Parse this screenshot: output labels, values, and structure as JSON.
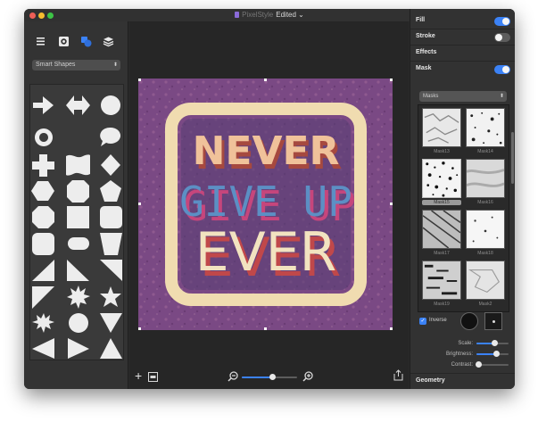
{
  "window": {
    "app_name": "PixelStyle",
    "doc_title": "Edited",
    "title_chevron": "⌄"
  },
  "left_panel": {
    "toolbar_icons": [
      "list-icon",
      "gear-icon",
      "shapes-icon",
      "layers-icon"
    ],
    "shape_category": "Smart Shapes",
    "shapes": [
      "arrow-right",
      "arrow-double",
      "circle",
      "ring",
      "crescent",
      "speech-bubble",
      "cross",
      "wave-flag",
      "diamond",
      "hexagon",
      "octagon-rounded",
      "pentagon",
      "octagon",
      "square",
      "rounded-square",
      "rounded-rect",
      "pill",
      "trapezoid",
      "triangle-right-up",
      "triangle-right",
      "triangle-down-left",
      "triangle-down",
      "starburst",
      "star",
      "starburst-12",
      "starburst-24",
      "triangle-inverted",
      "triangle-left",
      "triangle-right-2",
      "triangle-up"
    ]
  },
  "artwork": {
    "line1": "NEVER",
    "line2": "GIVE UP",
    "line3": "EVER",
    "bg_color": "#7d4a85",
    "frame_color": "#f3e2b6"
  },
  "canvas_bottom": {
    "add_label": "+",
    "zoom_value": 0.55
  },
  "right_panel": {
    "fill": {
      "label": "Fill",
      "on": true
    },
    "stroke": {
      "label": "Stroke",
      "on": false
    },
    "effects": {
      "label": "Effects"
    },
    "mask": {
      "label": "Mask",
      "on": true
    },
    "masks_select": "Masks",
    "masks": [
      {
        "name": "Mask13",
        "selected": false
      },
      {
        "name": "Mask14",
        "selected": false
      },
      {
        "name": "Mask15",
        "selected": true
      },
      {
        "name": "Mask16",
        "selected": false
      },
      {
        "name": "Mask17",
        "selected": false
      },
      {
        "name": "Mask18",
        "selected": false
      },
      {
        "name": "Mask19",
        "selected": false
      },
      {
        "name": "Mask2",
        "selected": false
      }
    ],
    "inverse_label": "Inverse",
    "inverse_checked": true,
    "scale_label": "Scale:",
    "scale_value": 0.55,
    "brightness_label": "Brightness:",
    "brightness_value": 0.6,
    "contrast_label": "Contrast:",
    "contrast_value": 0.05,
    "geometry_label": "Geometry"
  },
  "colors": {
    "accent": "#3b82f6",
    "toggle_off": "#5d5d5d"
  }
}
